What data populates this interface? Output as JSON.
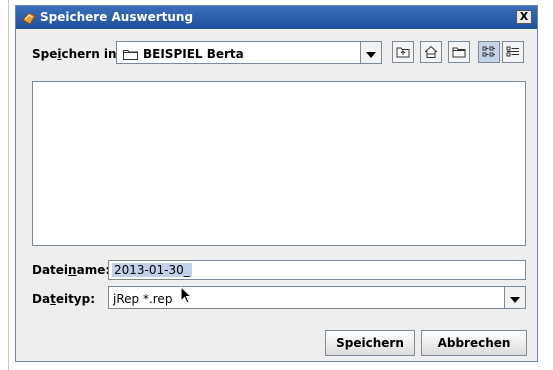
{
  "window": {
    "title": "Speichere Auswertung",
    "close_label": "X"
  },
  "save_in": {
    "label_pre": "Spe",
    "label_mnemonic": "i",
    "label_post": "chern in:",
    "value": "BEISPIEL Berta"
  },
  "toolbar": [
    {
      "icon": "up-one-level-icon",
      "pressed": false
    },
    {
      "icon": "home-icon",
      "pressed": false
    },
    {
      "icon": "new-folder-icon",
      "pressed": false
    },
    {
      "icon": "list-view-icon",
      "pressed": true
    },
    {
      "icon": "details-view-icon",
      "pressed": false
    }
  ],
  "filename": {
    "label_pre": "Datei",
    "label_mnemonic": "n",
    "label_post": "ame:",
    "value": "2013-01-30_"
  },
  "filetype": {
    "label_pre": "Da",
    "label_mnemonic": "t",
    "label_post": "eityp:",
    "value": "jRep  *.rep"
  },
  "buttons": {
    "save": "Speichern",
    "cancel": "Abbrechen"
  },
  "colors": {
    "titlebar": "#2b5ea8",
    "selection": "#c0d2ea",
    "dialog_bg": "#eeeeee"
  }
}
